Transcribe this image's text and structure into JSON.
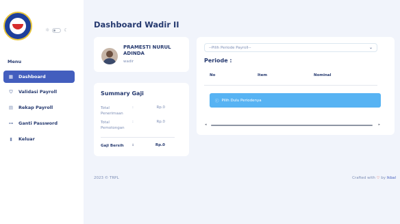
{
  "sidebar": {
    "menu_title": "Menu",
    "items": [
      {
        "label": "Dashboard",
        "icon": "grid-icon",
        "active": true
      },
      {
        "label": "Validasi Payroll",
        "icon": "shield-check-icon",
        "active": false
      },
      {
        "label": "Rekap Payroll",
        "icon": "file-text-icon",
        "active": false
      },
      {
        "label": "Ganti Password",
        "icon": "key-icon",
        "active": false
      },
      {
        "label": "Keluar",
        "icon": "door-icon",
        "active": false
      }
    ]
  },
  "page": {
    "title": "Dashboard Wadir II"
  },
  "profile": {
    "name": "PRAMESTI NURUL ADINDA",
    "role": "wadir"
  },
  "summary": {
    "title": "Summary Gaji",
    "rows": [
      {
        "label": "Total Penerimaan",
        "colon": ":",
        "value": "Rp.0"
      },
      {
        "label": "Total Pemotongan",
        "colon": ":",
        "value": "Rp.0"
      }
    ],
    "net": {
      "label": "Gaji Bersih",
      "colon": ":",
      "value": "Rp.0"
    }
  },
  "payroll": {
    "select_placeholder": "--Pilih Periode Payroll--",
    "periode_label": "Periode :",
    "columns": [
      "No",
      "Item",
      "Nominal"
    ],
    "alert_text": "Pilih Dulu Periodenya"
  },
  "footer": {
    "copyright": "2023 © TRPL",
    "crafted_prefix": "Crafted with",
    "crafted_by": "by",
    "author": "Ikbal"
  },
  "colors": {
    "accent": "#435ebe",
    "alert": "#57b3f3",
    "background": "#f1f4fb",
    "heart": "#e0453a"
  }
}
